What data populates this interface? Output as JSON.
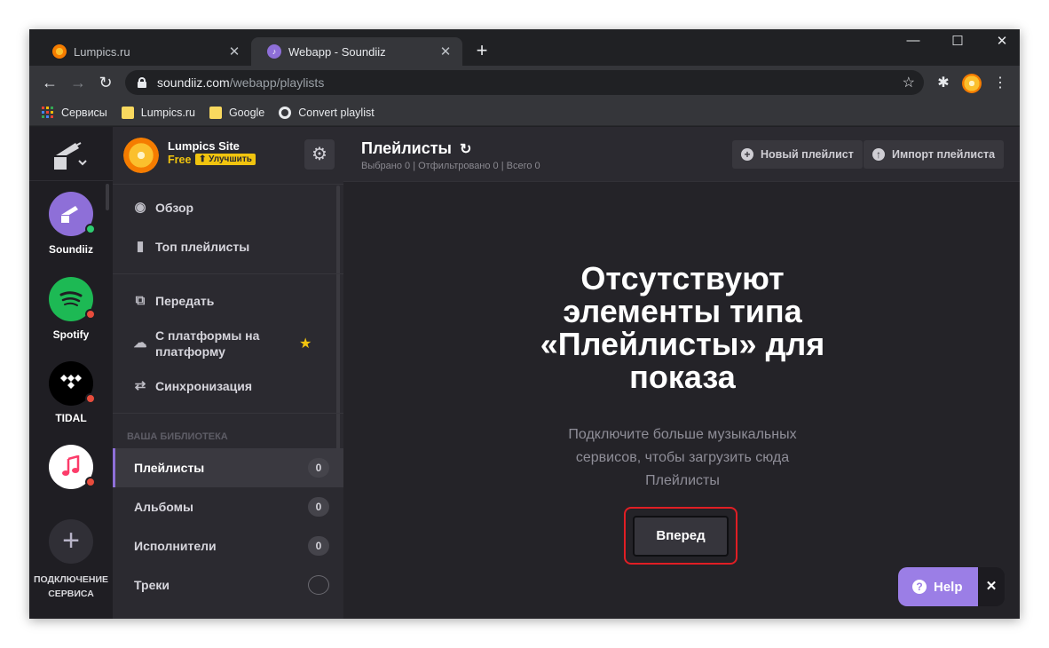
{
  "browser": {
    "tabs": [
      {
        "title": "Lumpics.ru",
        "active": false
      },
      {
        "title": "Webapp - Soundiiz",
        "active": true
      }
    ],
    "new_tab_label": "+",
    "url_host": "soundiiz.com",
    "url_path": "/webapp/playlists",
    "bookmarks": [
      "Сервисы",
      "Lumpics.ru",
      "Google",
      "Convert playlist"
    ]
  },
  "rail": {
    "services": [
      {
        "name": "Soundiiz",
        "status_color": "#2ecc71",
        "bg": "#8e6fd8"
      },
      {
        "name": "Spotify",
        "status_color": "#e74c3c",
        "bg": "#1db954"
      },
      {
        "name": "TIDAL",
        "status_color": "#e74c3c",
        "bg": "#000000"
      },
      {
        "name": "Apple Music",
        "status_color": "#e74c3c",
        "bg": "#ffffff"
      }
    ],
    "add_label_1": "ПОДКЛЮЧЕНИЕ",
    "add_label_2": "СЕРВИСА"
  },
  "account": {
    "name": "Lumpics Site",
    "plan": "Free",
    "upgrade": "⬆ Улучшить"
  },
  "nav": {
    "overview": "Обзор",
    "top": "Топ плейлисты",
    "transfer": "Передать",
    "platform_1": "С платформы на",
    "platform_2": "платформу",
    "sync": "Синхронизация"
  },
  "library": {
    "section": "ВАША БИБЛИОТЕКА",
    "items": [
      {
        "label": "Плейлисты",
        "count": "0"
      },
      {
        "label": "Альбомы",
        "count": "0"
      },
      {
        "label": "Исполнители",
        "count": "0"
      },
      {
        "label": "Треки"
      }
    ]
  },
  "main": {
    "title": "Плейлисты",
    "subtitle": "Выбрано 0 | Отфильтровано 0 | Всего 0",
    "new_playlist": "Новый плейлист",
    "import_playlist": "Импорт плейлиста",
    "empty_title_1": "Отсутствуют",
    "empty_title_2": "элементы типа",
    "empty_title_3": "«Плейлисты» для",
    "empty_title_4": "показа",
    "empty_sub_1": "Подключите больше музыкальных",
    "empty_sub_2": "сервисов, чтобы загрузить сюда",
    "empty_sub_3": "Плейлисты",
    "forward": "Вперед"
  },
  "help": {
    "label": "Help"
  },
  "colors": {
    "accent": "#8e6fd8",
    "highlight": "#e01e24",
    "upgrade": "#f1c40f"
  }
}
